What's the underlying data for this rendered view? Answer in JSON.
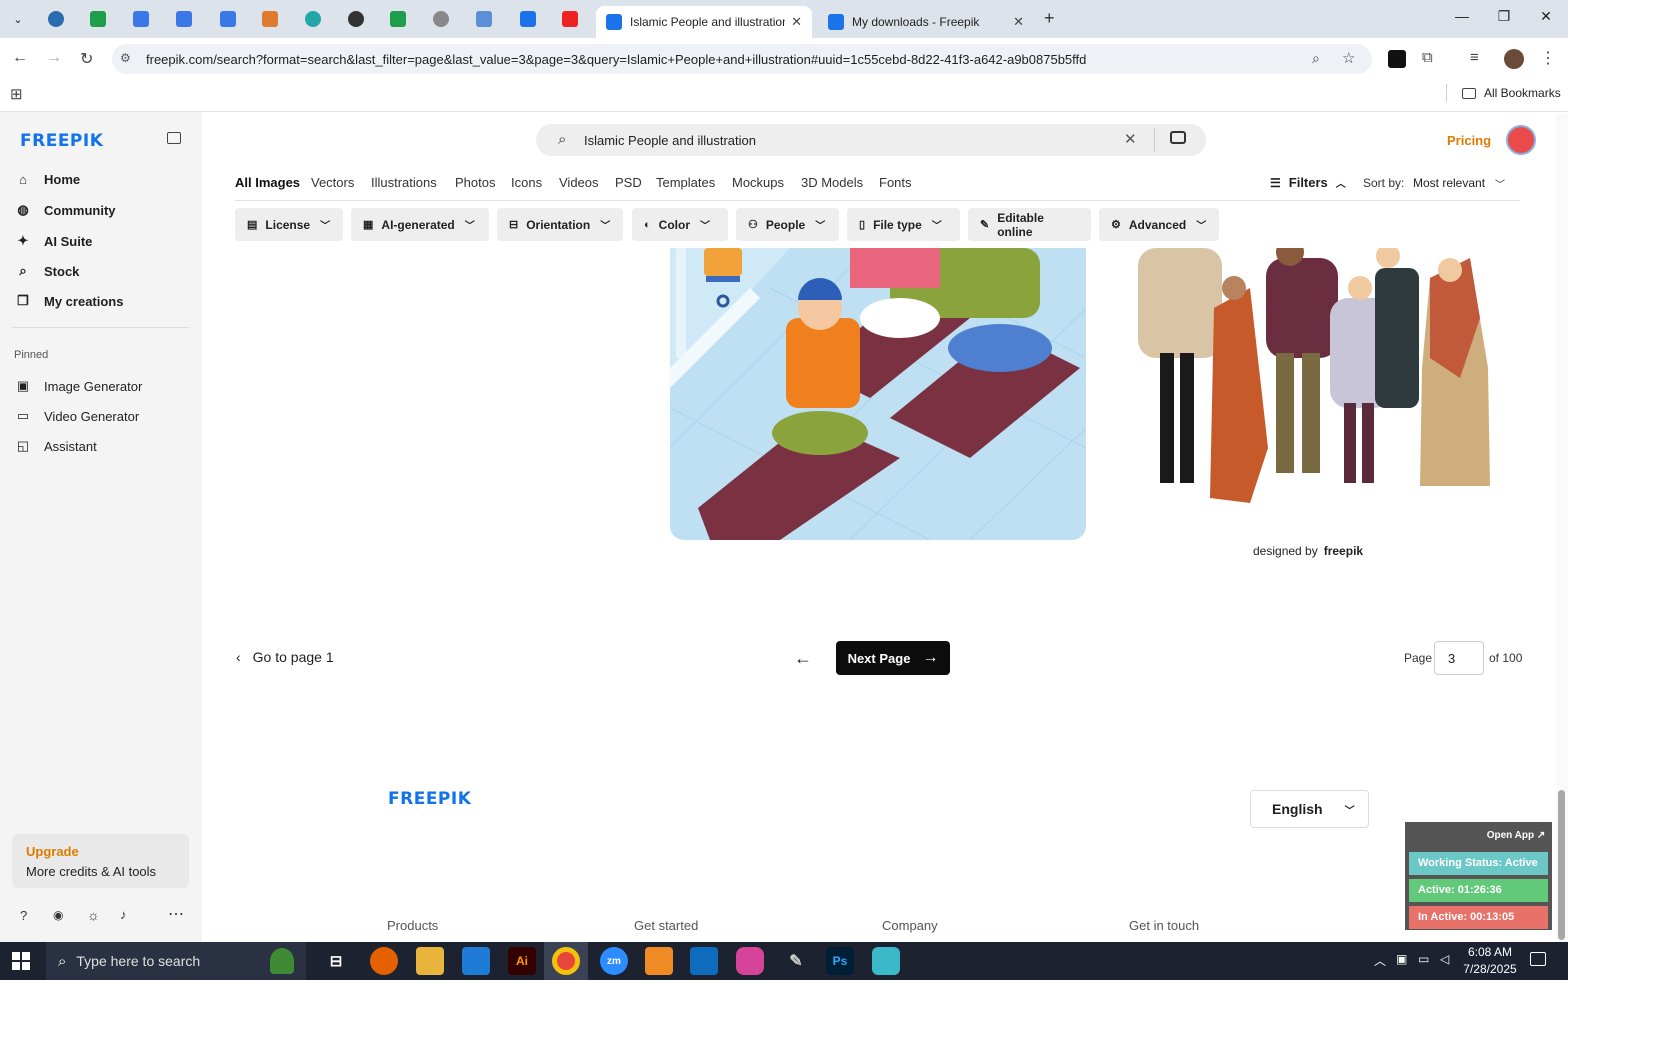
{
  "browser": {
    "tabs": [
      {
        "title": "Islamic People and illustration v",
        "active": true
      },
      {
        "title": "My downloads - Freepik",
        "active": false
      }
    ],
    "new_tab": "+",
    "url": "freepik.com/search?format=search&last_filter=page&last_value=3&page=3&query=Islamic+People+and+illustration#uuid=1c55cebd-8d22-41f3-a642-a9b0875b5ffd",
    "bookmarks_label": "All Bookmarks"
  },
  "sidebar": {
    "logo": "FREEPIK",
    "nav": [
      {
        "label": "Home",
        "icon": "home-icon"
      },
      {
        "label": "Community",
        "icon": "globe-icon"
      },
      {
        "label": "AI Suite",
        "icon": "sparkle-icon"
      },
      {
        "label": "Stock",
        "icon": "search-icon"
      },
      {
        "label": "My creations",
        "icon": "stack-icon"
      }
    ],
    "pinned_label": "Pinned",
    "pinned": [
      {
        "label": "Image Generator",
        "icon": "image-icon"
      },
      {
        "label": "Video Generator",
        "icon": "video-icon"
      },
      {
        "label": "Assistant",
        "icon": "chat-icon"
      }
    ],
    "upgrade": {
      "title": "Upgrade",
      "subtitle": "More credits & AI tools"
    }
  },
  "search": {
    "value": "Islamic People and illustration"
  },
  "header": {
    "pricing": "Pricing"
  },
  "content_tabs": [
    "All Images",
    "Vectors",
    "Illustrations",
    "Photos",
    "Icons",
    "Videos",
    "PSD",
    "Templates",
    "Mockups",
    "3D Models",
    "Fonts"
  ],
  "filters": {
    "label": "Filters",
    "sort_label": "Sort by:",
    "sort_value": "Most relevant",
    "chips": [
      "License",
      "AI-generated",
      "Orientation",
      "Color",
      "People",
      "File type",
      "Editable online",
      "Advanced"
    ]
  },
  "results": {
    "credit": "designed by",
    "credit_brand": "freepik"
  },
  "pagination": {
    "go_to_first": "Go to page 1",
    "next": "Next Page",
    "page_label": "Page",
    "page_value": "3",
    "of_label": "of 100"
  },
  "footer": {
    "logo": "FREEPIK",
    "language": "English",
    "columns": [
      "Products",
      "Get started",
      "Company",
      "Get in touch"
    ]
  },
  "widget": {
    "open_app": "Open App ↗",
    "status": "Working Status: Active",
    "active": "Active: 01:26:36",
    "inactive": "In Active: 00:13:05"
  },
  "taskbar": {
    "search_placeholder": "Type here to search",
    "time": "6:08 AM",
    "date": "7/28/2025"
  },
  "colors": {
    "brand_blue": "#1273eb",
    "pricing_orange": "#e07b00",
    "tab_bar": "#dde3ea",
    "status_teal": "#6cc7c7",
    "active_green": "#63c97a",
    "inactive_red": "#e8716a"
  }
}
